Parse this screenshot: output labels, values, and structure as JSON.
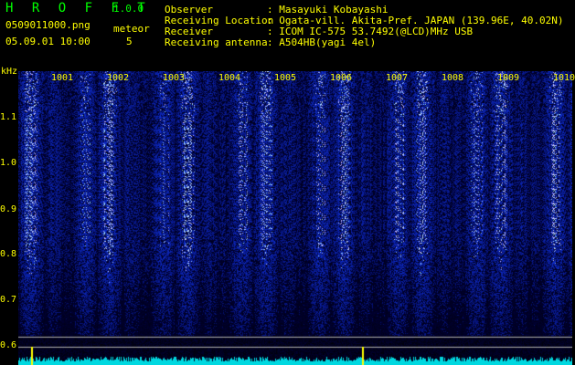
{
  "header": {
    "brand": "H R O F F T",
    "version": "1.0.0",
    "filename": "0509011000.png",
    "datetime": "05.09.01 10:00",
    "meteor_label": "meteor",
    "meteor_count": "5"
  },
  "info": {
    "observer_label": "Observer",
    "observer_value": ": Masayuki Kobayashi",
    "location_label": "Receiving Location",
    "location_value": ": Ogata-vill. Akita-Pref. JAPAN (139.96E, 40.02N)",
    "receiver_label": "Receiver",
    "receiver_value": ": ICOM IC-575 53.7492(@LCD)MHz USB",
    "antenna_label": "Receiving antenna",
    "antenna_value": ": A504HB(yagi 4el)"
  },
  "axis": {
    "unit": "kHz",
    "yticks": [
      "1.1",
      "1.0",
      "0.9",
      "0.8",
      "0.7",
      "0.6"
    ],
    "minute_ticks": [
      "1001",
      "1002",
      "1003",
      "1004",
      "1005",
      "1006",
      "1007",
      "1008",
      "1009",
      "1010"
    ]
  },
  "colors": {
    "text": "#ffff00",
    "brand": "#00ff00",
    "spectrum_dark": "#000030",
    "spectrum_mid": "#1030c0",
    "spectrum_bright": "#a0c0ff",
    "power_trace": "#00e0e0"
  }
}
